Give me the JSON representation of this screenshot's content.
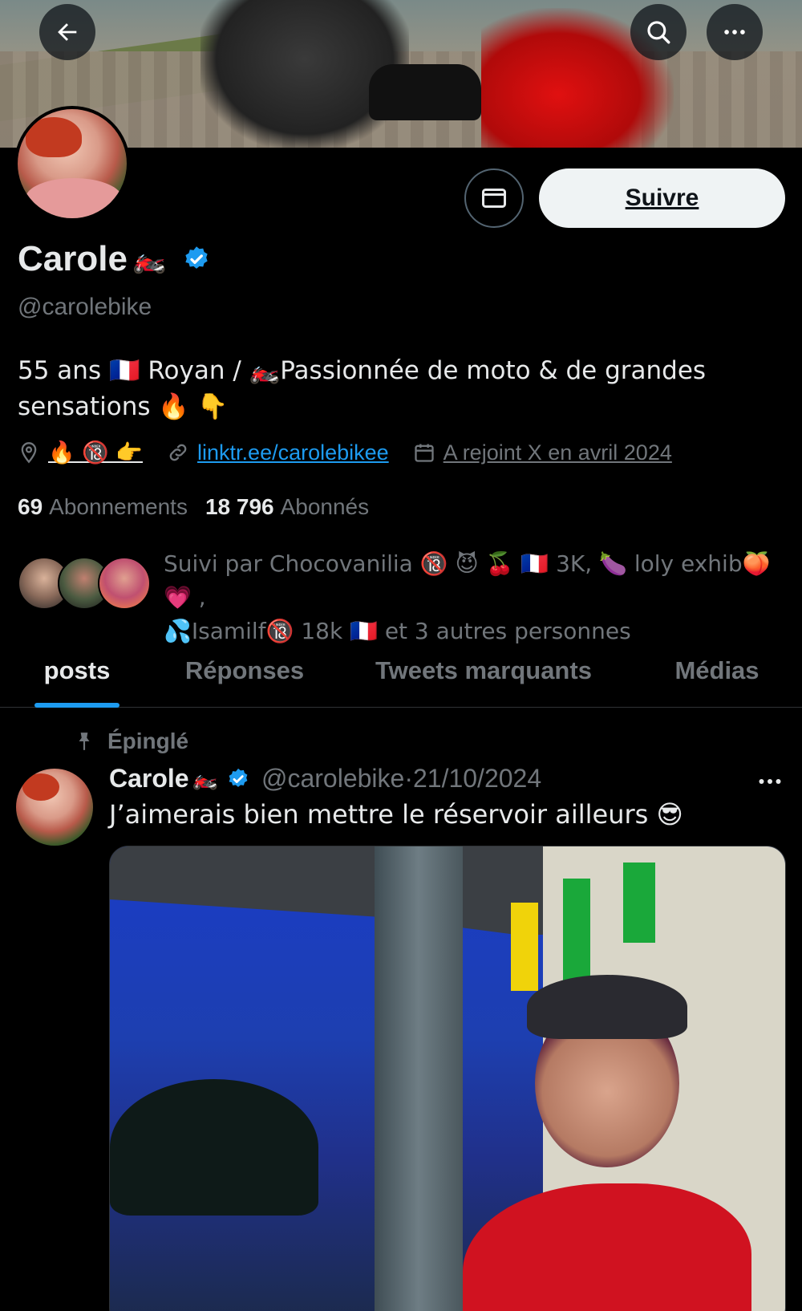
{
  "header": {
    "back_icon": "arrow-left-icon",
    "search_icon": "search-icon",
    "more_icon": "more-horizontal-icon"
  },
  "profile": {
    "name": "Carole",
    "name_emoji": "🏍️",
    "handle": "@carolebike",
    "bio_line1": "55 ans 🇫🇷 Royan / 🏍️Passionnée de moto & de grandes",
    "bio_line2": "sensations 🔥 👇",
    "location": "🔥 🔞 👉",
    "link": "linktr.ee/carolebikee",
    "joined": "A rejoint X en avril 2024",
    "following_count": "69",
    "following_label": "Abonnements",
    "followers_count": "18 796",
    "followers_label": "Abonnés",
    "followed_by_line1": "Suivi par Chocovanilia 🔞 😈 🍒 🇫🇷 3K, 🍆 loly exhib🍑 💗 ,",
    "followed_by_line2": "💦Isamilf🔞 18k 🇫🇷 et 3 autres personnes",
    "follow_label": "Suivre",
    "verified_color": "#1d9bf0"
  },
  "tabs": [
    {
      "label": "posts",
      "active": true
    },
    {
      "label": "Réponses",
      "active": false
    },
    {
      "label": "Tweets marquants",
      "active": false
    },
    {
      "label": "Médias",
      "active": false
    }
  ],
  "post": {
    "pinned_label": "Épinglé",
    "author_name": "Carole",
    "author_emoji": "🏍️",
    "author_handle": "@carolebike",
    "date": "·21/10/2024",
    "text": "J’aimerais bien mettre le réservoir ailleurs 😎"
  },
  "colors": {
    "background": "#000000",
    "accent": "#1d9bf0",
    "secondary_text": "#71767b"
  }
}
